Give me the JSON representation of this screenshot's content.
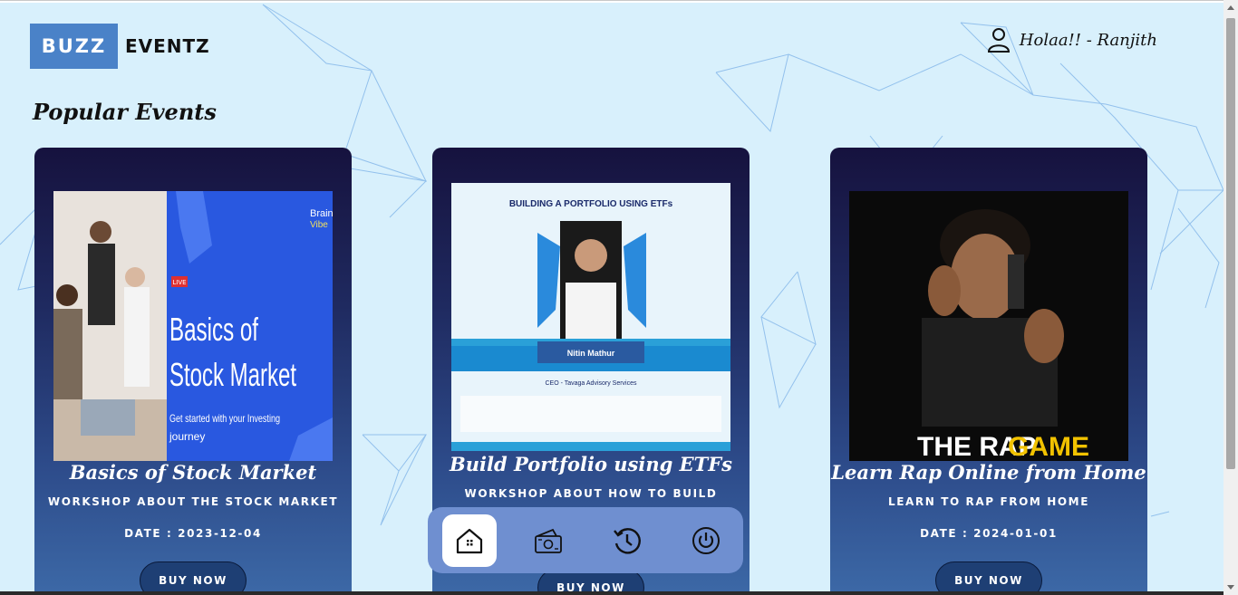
{
  "brand": {
    "box_text": "BUZZ",
    "text": "EVENTZ",
    "accent": "#4a82c8"
  },
  "header": {
    "greeting": "Holaa!! - Ranjith",
    "user_icon": "user-icon"
  },
  "section": {
    "title": "Popular Events"
  },
  "events": [
    {
      "title": "Basics of Stock Market",
      "description": "WORKSHOP ABOUT THE STOCK MARKET",
      "date": "DATE : 2023-12-04",
      "button": "BUY NOW",
      "poster": {
        "badge": "LIVE",
        "heading_1": "Basics of",
        "heading_2": "Stock Market",
        "sub_1": "Get started with your  Investing",
        "sub_2": "journey",
        "brand_1": "Brain",
        "brand_2": "Vibe"
      }
    },
    {
      "title": "Build Portfolio using ETFs",
      "description": "WORKSHOP ABOUT HOW TO BUILD",
      "date": "",
      "button": "BUY NOW",
      "poster": {
        "heading": "BUILDING A PORTFOLIO USING ETFs",
        "name": "Nitin Mathur",
        "role": "CEO - Tavaga Advisory Services"
      }
    },
    {
      "title": "Learn Rap Online from Home",
      "description": "LEARN TO RAP FROM HOME",
      "date": "DATE : 2024-01-01",
      "button": "BUY NOW",
      "poster": {
        "heading_1": "THE RAP ",
        "heading_2": "GAME"
      }
    }
  ],
  "dock": [
    {
      "icon": "home-icon",
      "active": true
    },
    {
      "icon": "wallet-icon",
      "active": false
    },
    {
      "icon": "history-icon",
      "active": false
    },
    {
      "icon": "power-icon",
      "active": false
    }
  ]
}
